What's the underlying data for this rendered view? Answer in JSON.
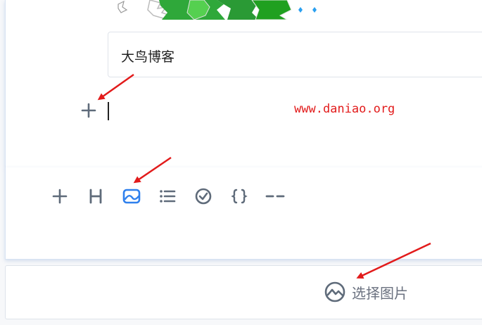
{
  "editor": {
    "title_value": "大鸟博客",
    "watermark": "www.daniao.org"
  },
  "toolbar": {
    "items": [
      {
        "icon": "plus-icon",
        "active": false
      },
      {
        "icon": "heading-icon",
        "active": false
      },
      {
        "icon": "image-icon",
        "active": true
      },
      {
        "icon": "list-icon",
        "active": false
      },
      {
        "icon": "checkbox-icon",
        "active": false
      },
      {
        "icon": "code-braces-icon",
        "active": false
      },
      {
        "icon": "divider-icon",
        "active": false
      }
    ]
  },
  "picker": {
    "label": "选择图片",
    "icon": "image-icon"
  },
  "colors": {
    "icon_gray": "#5f6b7a",
    "active_blue": "#2f80ed",
    "annotation_red": "#e21b1b",
    "map_green": "#2fa83a"
  }
}
